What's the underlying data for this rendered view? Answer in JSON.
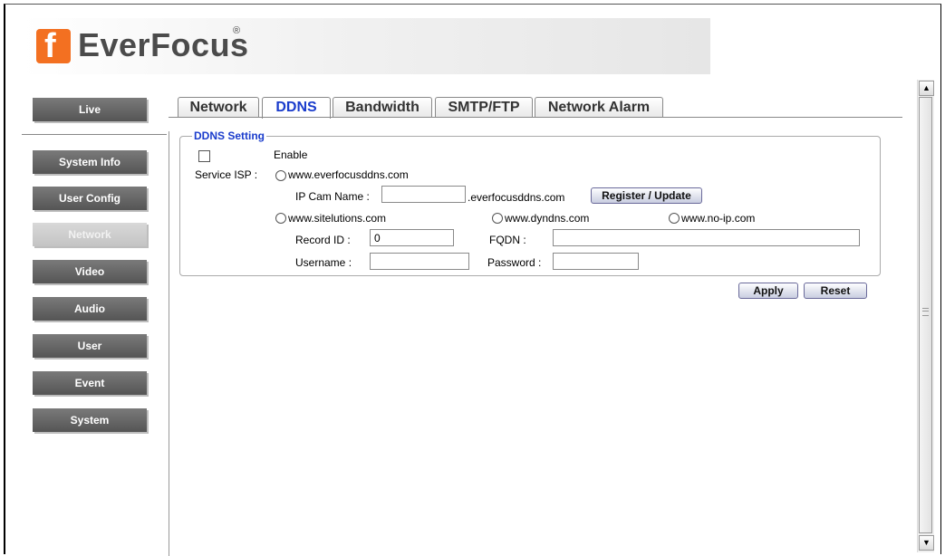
{
  "brand": {
    "name": "EverFocus",
    "registered": "®"
  },
  "sidebar": {
    "items": [
      {
        "label": "Live"
      },
      {
        "label": "System Info"
      },
      {
        "label": "User Config"
      },
      {
        "label": "Network",
        "active": true
      },
      {
        "label": "Video"
      },
      {
        "label": "Audio"
      },
      {
        "label": "User"
      },
      {
        "label": "Event"
      },
      {
        "label": "System"
      }
    ]
  },
  "tabs": [
    {
      "label": "Network"
    },
    {
      "label": "DDNS",
      "active": true
    },
    {
      "label": "Bandwidth"
    },
    {
      "label": "SMTP/FTP"
    },
    {
      "label": "Network Alarm"
    }
  ],
  "ddns": {
    "legend": "DDNS Setting",
    "enable_label": "Enable",
    "enabled": false,
    "service_isp_label": "Service ISP :",
    "isp_everfocus": "www.everfocusddns.com",
    "ip_cam_name_label": "IP Cam Name :",
    "ip_cam_name_value": "",
    "domain_suffix": ".everfocusddns.com",
    "register_label": "Register / Update",
    "isp_sitelutions": "www.sitelutions.com",
    "isp_dyndns": "www.dyndns.com",
    "isp_noip": "www.no-ip.com",
    "record_id_label": "Record ID :",
    "record_id_value": "0",
    "fqdn_label": "FQDN :",
    "fqdn_value": "",
    "username_label": "Username :",
    "username_value": "",
    "password_label": "Password :",
    "password_value": ""
  },
  "actions": {
    "apply_label": "Apply",
    "reset_label": "Reset"
  },
  "colors": {
    "accent": "#1a3ccc",
    "brand_orange": "#f37021",
    "nav_button": "#666666"
  }
}
